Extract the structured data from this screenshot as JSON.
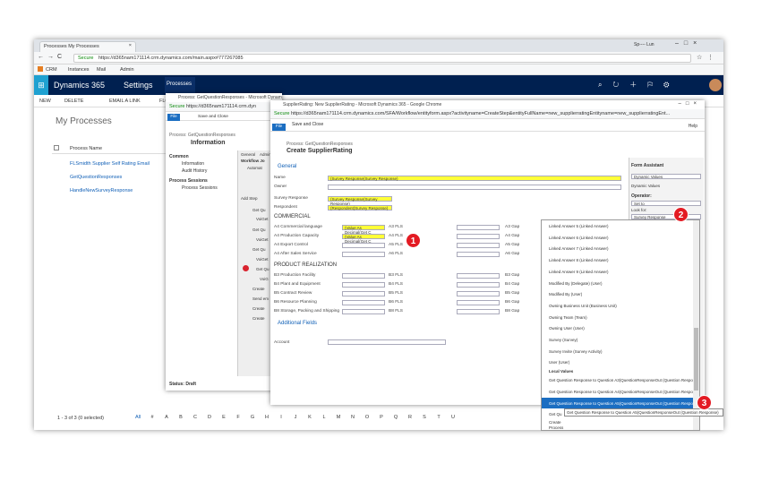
{
  "browser": {
    "tab_title": "Processes My Processes",
    "close_glyph": "×",
    "user_label": "Sp---- Lun",
    "secure_label": "Secure",
    "url": "https://d365nam171114.crm.dynamics.com/main.aspx#777267085",
    "bookmarks": [
      "CRM",
      "Instances",
      "Mail",
      "Admin"
    ]
  },
  "dynamics": {
    "app_name": "Dynamics 365",
    "area": "Settings",
    "section": "Processes",
    "commands": [
      "NEW",
      "DELETE",
      "EMAIL A LINK",
      "FLO"
    ],
    "view_title": "My Processes",
    "column_header": "Process Name",
    "rows": [
      "FLSmidth Supplier Self Rating Email",
      "GetQuestionResponses",
      "HandleNewSurveyResponse"
    ],
    "record_count": "1 - 3 of 3 (0 selected)",
    "alpha": [
      "All",
      "#",
      "A",
      "B",
      "C",
      "D",
      "E",
      "F",
      "G",
      "H",
      "I",
      "J",
      "K",
      "L",
      "M",
      "N",
      "O",
      "P",
      "Q",
      "R",
      "S",
      "T",
      "U"
    ]
  },
  "process_window": {
    "title": "Process: GetQuestionResponses - Microsoft Dynamics 365 - Google Chrome",
    "secure_label": "Secure",
    "url": "https://d365nam171114.crm.dyn",
    "save_close": "Save and Close",
    "file": "File",
    "breadcrumb": "Process: GetQuestionResponses",
    "heading": "Information",
    "common_header": "Common",
    "common_items": [
      "Information",
      "Audit History"
    ],
    "sessions_header": "Process Sessions",
    "session_items": [
      "Process Sessions"
    ],
    "tabs": [
      "General",
      "Admin"
    ],
    "workflow_label": "Workflow Jo",
    "auto_label": "Automat",
    "add_step": "Add Step",
    "steps": [
      "Get Qu",
      "VoiGet",
      "Get Qu",
      "VoiGet",
      "Get Qu",
      "VoiGet",
      "Get Qu",
      "VoiG",
      "Create",
      "Send em",
      "Create",
      "Create"
    ],
    "status": "Status: Draft"
  },
  "create_window": {
    "title": "SupplierRating: New SupplierRating - Microsoft Dynamics 365 - Google Chrome",
    "secure_label": "Secure",
    "url": "https://d365nam171114.crm.dynamics.com/SFA/Workflow/entityform.aspx?activityname=CreateStep&entityFullName=new_supplierratingEntityname=new_supplierratingEnt...",
    "file": "File",
    "save_close": "Save and Close",
    "help": "Help",
    "breadcrumb": "Process: GetQuestionResponses",
    "heading": "Create SupplierRating",
    "section_general": "General",
    "name_label": "Name",
    "name_value": "(Survey Response(Survey Response)",
    "owner_label": "Owner",
    "survey_label": "Survey Response",
    "survey_value": "(Survey Response(Survey Response)",
    "respondent_label": "Respondent",
    "respondent_value": "(Respondent(Survey Response)",
    "commercial_header": "COMMERCIAL",
    "commercial_rows": [
      {
        "label": "A4 Commercial language",
        "value": "(Value As Decimal(Get C",
        "fls": "A3 FLS",
        "gap": "A3 Gap"
      },
      {
        "label": "A4 Production Capacity",
        "value": "(Value As Decimal(Get C",
        "fls": "A4 FLS",
        "gap": "A4 Gap"
      },
      {
        "label": "A4 Export Control",
        "value": "",
        "fls": "A5 FLS",
        "gap": "A5 Gap"
      },
      {
        "label": "A4 After Sales Service",
        "value": "",
        "fls": "A6 FLS",
        "gap": "A6 Gap"
      }
    ],
    "product_header": "PRODUCT REALIZATION",
    "product_rows": [
      {
        "label": "B3 Production Facility",
        "fls": "B3 FLS",
        "gap": "B3 Gap"
      },
      {
        "label": "B4 Plant and Equipment",
        "fls": "B4 FLS",
        "gap": "B4 Gap"
      },
      {
        "label": "B5 Contract Review",
        "fls": "B5 FLS",
        "gap": "B5 Gap"
      },
      {
        "label": "B6 Resource Planning",
        "fls": "B6 FLS",
        "gap": "B6 Gap"
      },
      {
        "label": "B8 Storage, Packing and Shipping",
        "fls": "B8 FLS",
        "gap": "B8 Gap"
      }
    ],
    "additional_fields": "Additional Fields",
    "account_label": "Account"
  },
  "form_assistant": {
    "title": "Form Assistant",
    "dynamic_select": "Dynamic Values",
    "dynamic_values": "Dynamic Values",
    "operator_label": "Operator:",
    "set_to": "Set to",
    "look_for_label": "Look for:",
    "look_for_value": "Survey Response"
  },
  "dropdown": {
    "items": [
      "Linked Answer 5 (Linked Answer)",
      "Linked Answer 6 (Linked Answer)",
      "Linked Answer 7 (Linked Answer)",
      "Linked Answer 8 (Linked Answer)",
      "Linked Answer 9 (Linked Answer)",
      "Modified By (Delegate) (User)",
      "Modified By (User)",
      "Owning Business Unit (Business Unit)",
      "Owning Team (Team)",
      "Owning User (User)",
      "Survey (Survey)",
      "Survey Invite (Survey Activity)",
      "User (User)",
      "Local Values",
      "Get Question Response to Question A3(QuestionResponseOut (Question Response)",
      "Get Question Response to Question A4(QuestionResponseOut (Question Response)",
      "Get Question Response to Question A5(QuestionResponseOut (Question Response)",
      "Get Qu",
      "Create",
      "Process"
    ],
    "tooltip": "Get Question Response to Question A5(QuestionResponseOut (Question Response)"
  },
  "badges": [
    "1",
    "2",
    "3"
  ],
  "colors": {
    "dynamics_bar": "#002050",
    "highlight": "#ffff38",
    "badge": "#e31b23",
    "selection": "#1b6ec2"
  }
}
